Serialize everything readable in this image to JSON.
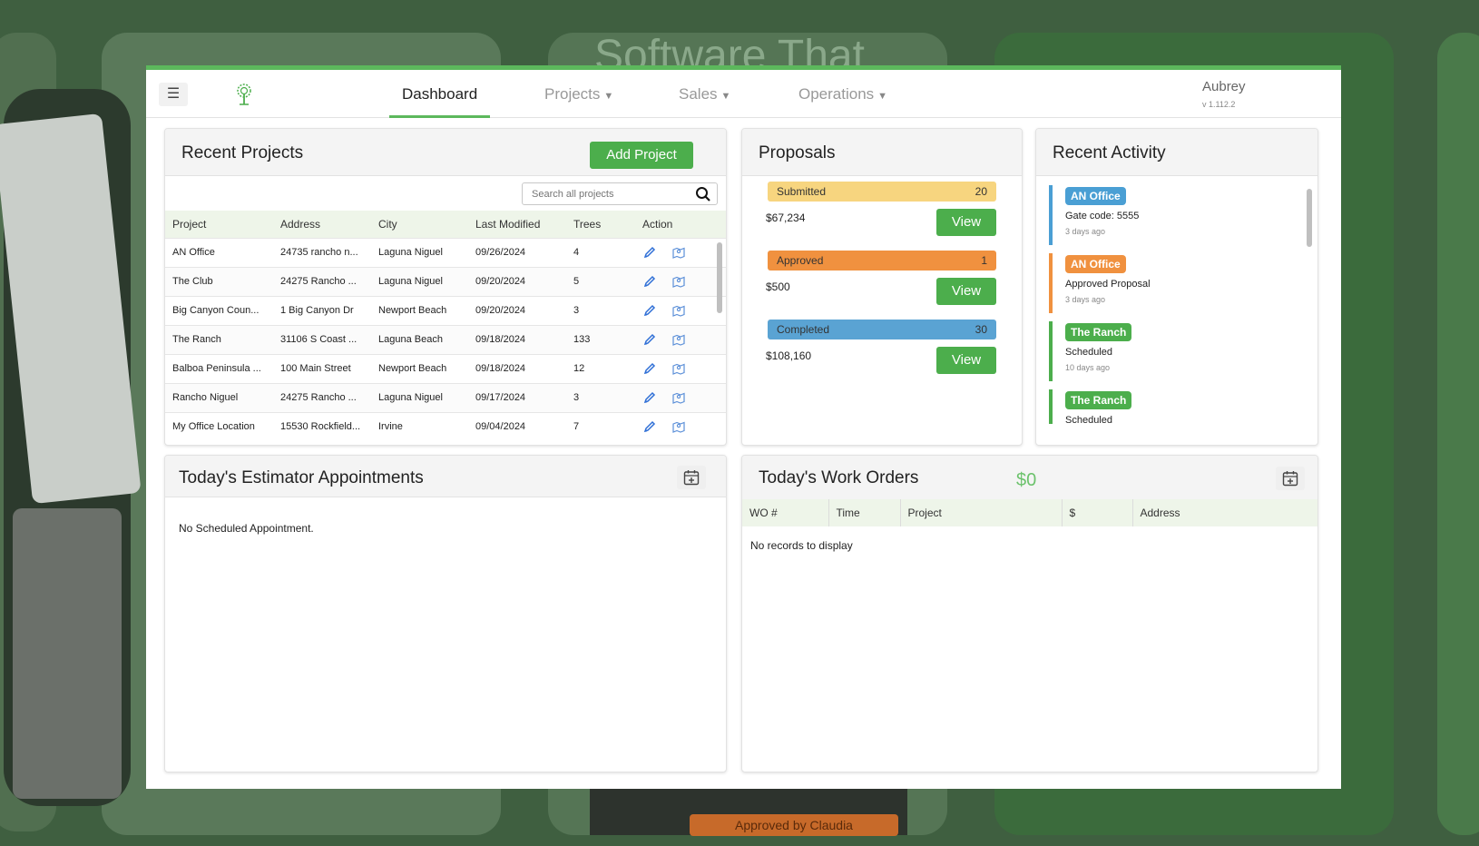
{
  "background": {
    "headline": "Software That",
    "bottom_tag": "Approved by Claudia"
  },
  "header": {
    "nav": [
      {
        "label": "Dashboard",
        "active": true
      },
      {
        "label": "Projects",
        "dropdown": true
      },
      {
        "label": "Sales",
        "dropdown": true
      },
      {
        "label": "Operations",
        "dropdown": true
      }
    ],
    "user_name": "Aubrey",
    "version": "v 1.112.2",
    "icons": {
      "menu": "hamburger-icon",
      "logo": "tree-logo-icon"
    }
  },
  "recent_projects": {
    "title": "Recent Projects",
    "add_label": "Add Project",
    "search_placeholder": "Search all projects",
    "columns": [
      "Project",
      "Address",
      "City",
      "Last Modified",
      "Trees",
      "Action"
    ],
    "rows": [
      {
        "project": "AN Office",
        "address": "24735 rancho n...",
        "city": "Laguna Niguel",
        "modified": "09/26/2024",
        "trees": "4"
      },
      {
        "project": "The Club",
        "address": "24275 Rancho ...",
        "city": "Laguna Niguel",
        "modified": "09/20/2024",
        "trees": "5"
      },
      {
        "project": "Big Canyon Coun...",
        "address": "1 Big Canyon Dr",
        "city": "Newport Beach",
        "modified": "09/20/2024",
        "trees": "3"
      },
      {
        "project": "The Ranch",
        "address": "31106 S Coast ...",
        "city": "Laguna Beach",
        "modified": "09/18/2024",
        "trees": "133"
      },
      {
        "project": "Balboa Peninsula ...",
        "address": "100 Main Street",
        "city": "Newport Beach",
        "modified": "09/18/2024",
        "trees": "12"
      },
      {
        "project": "Rancho Niguel",
        "address": "24275 Rancho ...",
        "city": "Laguna Niguel",
        "modified": "09/17/2024",
        "trees": "3"
      },
      {
        "project": "My Office Location",
        "address": "15530 Rockfield...",
        "city": "Irvine",
        "modified": "09/04/2024",
        "trees": "7"
      }
    ]
  },
  "proposals": {
    "title": "Proposals",
    "view_label": "View",
    "items": [
      {
        "status": "Submitted",
        "count": "20",
        "amount": "$67,234",
        "color": "#f7d57f"
      },
      {
        "status": "Approved",
        "count": "1",
        "amount": "$500",
        "color": "#f0913f"
      },
      {
        "status": "Completed",
        "count": "30",
        "amount": "$108,160",
        "color": "#5aa3d3"
      }
    ]
  },
  "recent_activity": {
    "title": "Recent Activity",
    "items": [
      {
        "badge": "AN Office",
        "desc": "Gate code: 5555",
        "time": "3 days ago",
        "color": "#4a9fd4"
      },
      {
        "badge": "AN Office",
        "desc": "Approved Proposal",
        "time": "3 days ago",
        "color": "#f0913f"
      },
      {
        "badge": "The Ranch",
        "desc": "Scheduled",
        "time": "10 days ago",
        "color": "#4cae4c"
      },
      {
        "badge": "The Ranch",
        "desc": "Scheduled",
        "time": "",
        "color": "#4cae4c"
      }
    ]
  },
  "estimator": {
    "title": "Today's Estimator Appointments",
    "empty": "No Scheduled Appointment."
  },
  "work_orders": {
    "title": "Today's Work Orders",
    "amount": "$0",
    "columns": [
      "WO #",
      "Time",
      "Project",
      "$",
      "Address"
    ],
    "empty": "No records to display"
  },
  "colors": {
    "accent": "#4cae4c",
    "background": "#3f5f40"
  }
}
